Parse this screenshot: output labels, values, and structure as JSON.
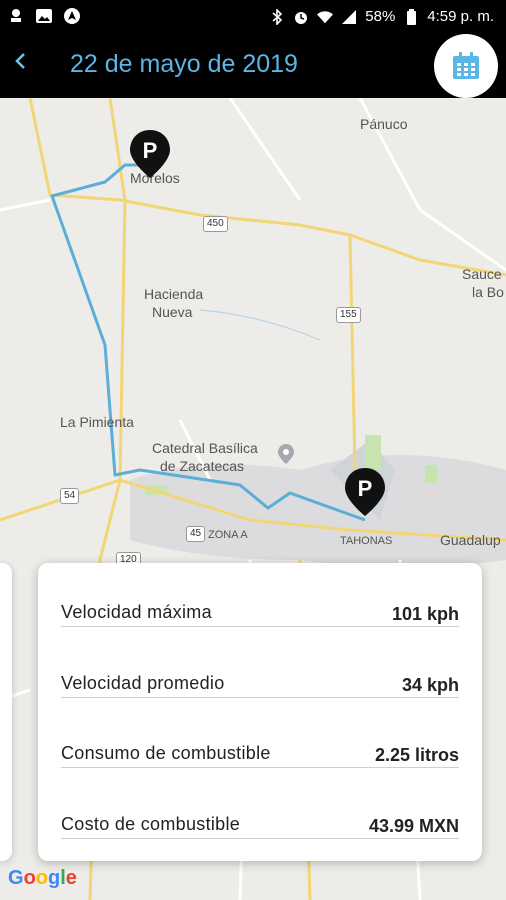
{
  "status_bar": {
    "battery": "58%",
    "time": "4:59 p. m.",
    "left_icons": [
      "notification-icon",
      "image-icon",
      "navigation-icon"
    ],
    "right_icons": [
      "bluetooth-icon",
      "alarm-icon",
      "wifi-icon",
      "battery-icon"
    ]
  },
  "header": {
    "back_icon": "chevron-left-icon",
    "title": "22 de mayo de 2019",
    "calendar_icon": "calendar-icon"
  },
  "map": {
    "labels": {
      "panuco": "Pánuco",
      "morelos": "Morelos",
      "sauceda_1": "Sauce",
      "sauceda_2": "la Bo",
      "hacienda_1": "Hacienda",
      "hacienda_2": "Nueva",
      "pimienta": "La Pimienta",
      "catedral_1": "Catedral Basílica",
      "catedral_2": "de Zacatecas",
      "tahonas": "TAHONAS",
      "guadalupe": "Guadalup",
      "zona": "ZONA A"
    },
    "shields": {
      "r450": "450",
      "r155": "155",
      "r54": "54",
      "r45": "45",
      "r120": "120"
    },
    "route_color": "#5aaed8",
    "marker_label": "P"
  },
  "stats": {
    "rows": [
      {
        "label": "Velocidad máxima",
        "value": "101 kph"
      },
      {
        "label": "Velocidad promedio",
        "value": "34 kph"
      },
      {
        "label": "Consumo de combustible",
        "value": "2.25 litros"
      },
      {
        "label": "Costo de combustible",
        "value": "43.99 MXN"
      }
    ]
  },
  "attribution": "Google"
}
